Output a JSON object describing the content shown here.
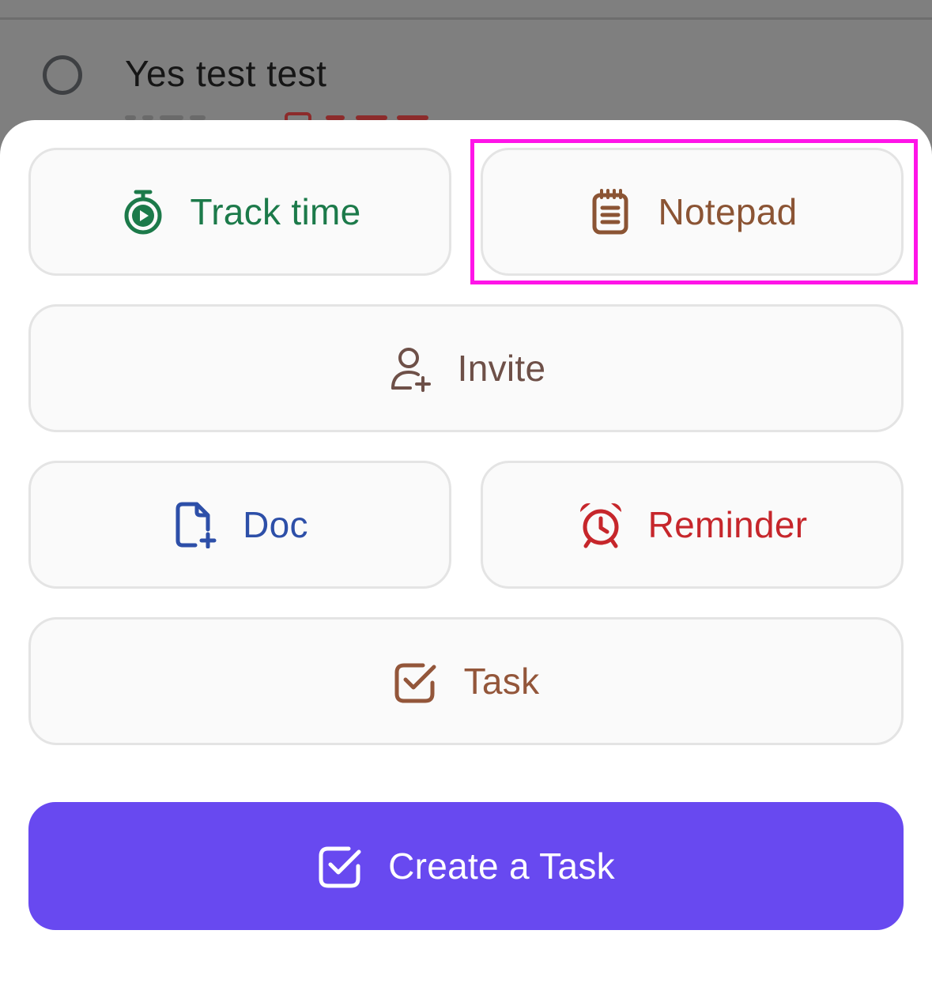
{
  "background_task": {
    "title": "Yes test test"
  },
  "actions": {
    "track_time": {
      "label": "Track time",
      "color": "#1c7a4a",
      "icon": "stopwatch-icon"
    },
    "notepad": {
      "label": "Notepad",
      "color": "#8b5434",
      "icon": "notepad-icon"
    },
    "invite": {
      "label": "Invite",
      "color": "#6e5048",
      "icon": "person-add-icon"
    },
    "doc": {
      "label": "Doc",
      "color": "#2d4fa8",
      "icon": "doc-add-icon"
    },
    "reminder": {
      "label": "Reminder",
      "color": "#c6262b",
      "icon": "alarm-clock-icon"
    },
    "task": {
      "label": "Task",
      "color": "#93563a",
      "icon": "checkbox-icon"
    }
  },
  "primary_button": {
    "label": "Create a Task",
    "color": "#6849f0",
    "icon": "checkbox-icon"
  },
  "highlight_color": "#ff14e8"
}
